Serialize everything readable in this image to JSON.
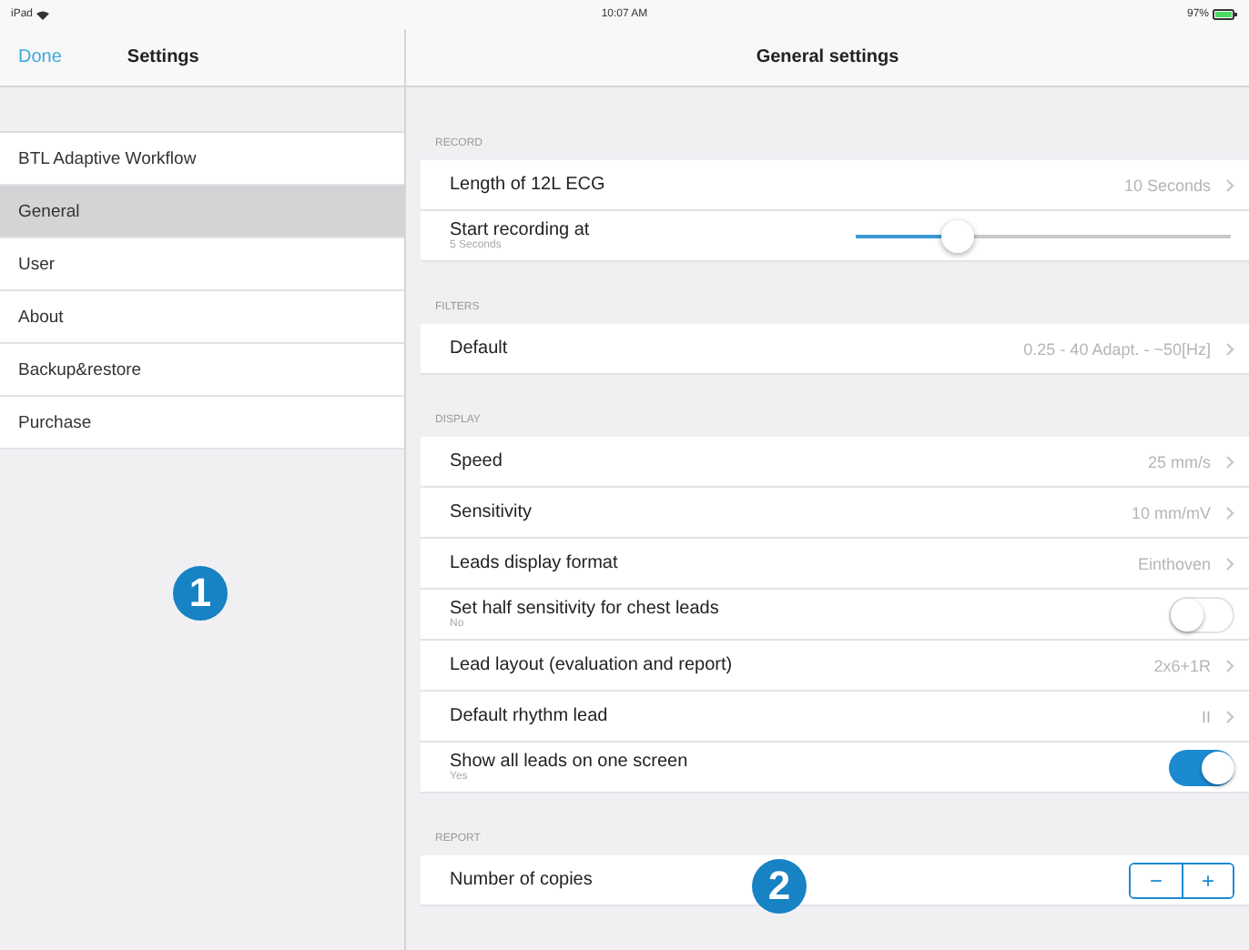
{
  "status_bar": {
    "carrier": "iPad",
    "time": "10:07 AM",
    "battery": "97%"
  },
  "sidebar": {
    "done": "Done",
    "title": "Settings",
    "items": [
      {
        "label": "BTL Adaptive Workflow",
        "selected": false
      },
      {
        "label": "General",
        "selected": true
      },
      {
        "label": "User",
        "selected": false
      },
      {
        "label": "About",
        "selected": false
      },
      {
        "label": "Backup&restore",
        "selected": false
      },
      {
        "label": "Purchase",
        "selected": false
      }
    ]
  },
  "detail": {
    "title": "General settings",
    "sections": [
      {
        "header": "RECORD",
        "rows": [
          {
            "kind": "value",
            "label": "Length of 12L ECG",
            "value": "10 Seconds"
          },
          {
            "kind": "slider",
            "label": "Start recording at",
            "subtitle": "5 Seconds",
            "level": 0.27
          }
        ]
      },
      {
        "header": "FILTERS",
        "rows": [
          {
            "kind": "value",
            "label": "Default",
            "value": "0.25 - 40 Adapt. - ~50[Hz]"
          }
        ]
      },
      {
        "header": "DISPLAY",
        "rows": [
          {
            "kind": "value",
            "label": "Speed",
            "value": "25 mm/s"
          },
          {
            "kind": "value",
            "label": "Sensitivity",
            "value": "10 mm/mV"
          },
          {
            "kind": "value",
            "label": "Leads display format",
            "value": "Einthoven"
          },
          {
            "kind": "toggle",
            "label": "Set half sensitivity for chest leads",
            "subtitle": "No",
            "on": false
          },
          {
            "kind": "value",
            "label": "Lead layout (evaluation and report)",
            "value": "2x6+1R"
          },
          {
            "kind": "value",
            "label": "Default rhythm lead",
            "value": "II"
          },
          {
            "kind": "toggle",
            "label": "Show all leads on one screen",
            "subtitle": "Yes",
            "on": true
          }
        ]
      },
      {
        "header": "REPORT",
        "rows": [
          {
            "kind": "stepper",
            "label": "Number of copies",
            "minus": "−",
            "plus": "+"
          }
        ]
      }
    ]
  },
  "markers": [
    {
      "label": "1"
    },
    {
      "label": "2"
    }
  ]
}
